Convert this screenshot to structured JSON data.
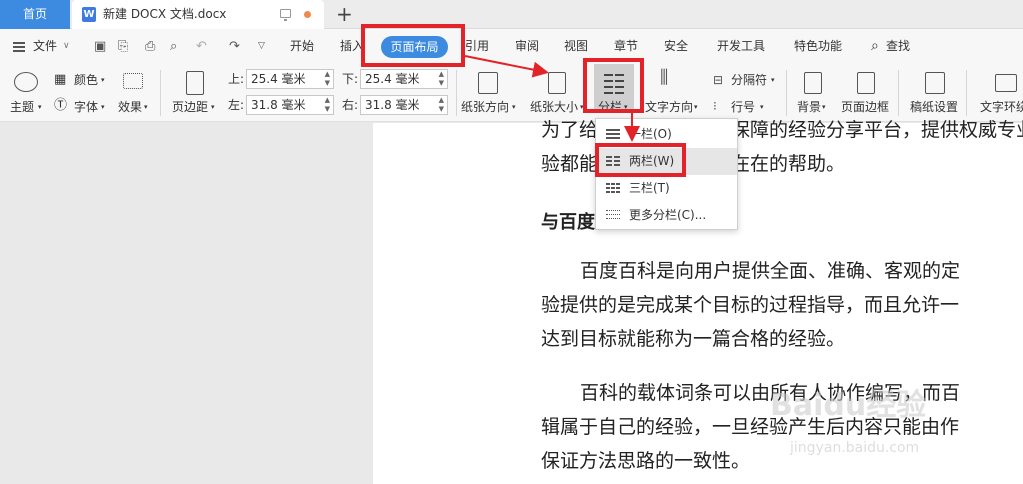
{
  "titlebar": {
    "home_tab": "首页",
    "doc_tab_icon": "W",
    "doc_tab_title": "新建 DOCX 文档.docx",
    "new_tab": "+"
  },
  "menubar": {
    "file": "文件",
    "items": [
      "开始",
      "插入",
      "页面布局",
      "引用",
      "审阅",
      "视图",
      "章节",
      "安全",
      "开发工具",
      "特色功能"
    ],
    "search": "查找",
    "active_tab": "页面布局"
  },
  "ribbon": {
    "theme": "主题",
    "color": "颜色",
    "font": "字体",
    "effect": "效果",
    "margins": "页边距",
    "top_label": "上:",
    "top_value": "25.4 毫米",
    "bottom_label": "下:",
    "bottom_value": "25.4 毫米",
    "left_label": "左:",
    "left_value": "31.8 毫米",
    "right_label": "右:",
    "right_value": "31.8 毫米",
    "orientation": "纸张方向",
    "paper_size": "纸张大小",
    "columns": "分栏",
    "text_direction": "文字方向",
    "separator": "分隔符",
    "line_numbers": "行号",
    "background": "背景",
    "page_border": "页面边框",
    "manuscript": "稿纸设置",
    "text_wrap": "文字环绕"
  },
  "columns_dropdown": {
    "items": [
      {
        "label": "一栏(O)"
      },
      {
        "label": "两栏(W)"
      },
      {
        "label": "三栏(T)"
      },
      {
        "label": "更多分栏(C)..."
      }
    ],
    "selected": "两栏(W)"
  },
  "document": {
    "line1": "为了给用户提供一个有保障的经验分享平台，提供权威专业的经验供",
    "line2": "验都能给用户带来实实在在的帮助。",
    "heading": "与百度百科的区别",
    "p1_l1": "百度百科是向用户提供全面、准确、客观的定",
    "p1_l2": "验提供的是完成某个目标的过程指导，而且允许一",
    "p1_l3": "达到目标就能称为一篇合格的经验。",
    "p2_l1": "百科的载体词条可以由所有人协作编写，而百",
    "p2_l2": "辑属于自己的经验，一旦经验产生后内容只能由作",
    "p2_l3": "保证方法思路的一致性。"
  },
  "watermark": {
    "main": "Baidu经验",
    "sub": "jingyan.baidu.com"
  },
  "colors": {
    "accent": "#3d8be0",
    "highlight": "#e3232a"
  }
}
